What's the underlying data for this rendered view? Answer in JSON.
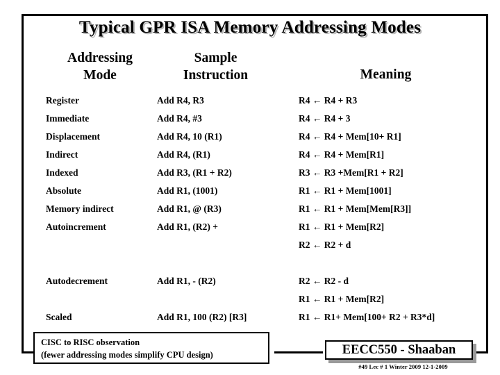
{
  "slide": {
    "title": "Typical GPR ISA Memory Addressing Modes"
  },
  "table": {
    "headers": {
      "mode_line1": "Addressing",
      "mode_line2": "Mode",
      "instruction_line1": "Sample",
      "instruction_line2": "Instruction",
      "meaning": "Meaning"
    },
    "rows": [
      {
        "mode": "Register",
        "instruction": "Add R4, R3",
        "meaning": "R4 ← R4 + R3"
      },
      {
        "mode": "Immediate",
        "instruction": "Add R4, #3",
        "meaning": "R4 ← R4 + 3"
      },
      {
        "mode": "Displacement",
        "instruction": "Add R4, 10 (R1)",
        "meaning": "R4 ← R4 + Mem[10+ R1]"
      },
      {
        "mode": "Indirect",
        "instruction": "Add R4, (R1)",
        "meaning": "R4 ← R4 + Mem[R1]"
      },
      {
        "mode": "Indexed",
        "instruction": "Add R3, (R1 + R2)",
        "meaning": "R3 ← R3 +Mem[R1 + R2]"
      },
      {
        "mode": "Absolute",
        "instruction": "Add R1, (1001)",
        "meaning": "R1 ← R1 + Mem[1001]"
      },
      {
        "mode": "Memory indirect",
        "instruction": "Add R1, @ (R3)",
        "meaning": "R1 ← R1 + Mem[Mem[R3]]"
      },
      {
        "mode": "Autoincrement",
        "instruction": "Add R1, (R2) +",
        "meaning": "R1 ← R1 +  Mem[R2]"
      },
      {
        "mode": "",
        "instruction": "",
        "meaning": "R2 ← R2 + d"
      },
      {
        "mode": "",
        "instruction": "",
        "meaning": ""
      },
      {
        "mode": "Autodecrement",
        "instruction": "Add R1, - (R2)",
        "meaning": "R2 ← R2 - d"
      },
      {
        "mode": "",
        "instruction": "",
        "meaning": "R1 ← R1 + Mem[R2]"
      },
      {
        "mode": "Scaled",
        "instruction": "Add R1, 100 (R2) [R3]",
        "meaning": "R1 ← R1+ Mem[100+ R2 + R3*d]"
      }
    ]
  },
  "footer": {
    "note_line1": "CISC to RISC observation",
    "note_line2": "(fewer addressing modes simplify CPU design)",
    "course_badge": "EECC550 - Shaaban",
    "course_footnote": "#49   Lec # 1  Winter 2009  12-1-2009"
  }
}
